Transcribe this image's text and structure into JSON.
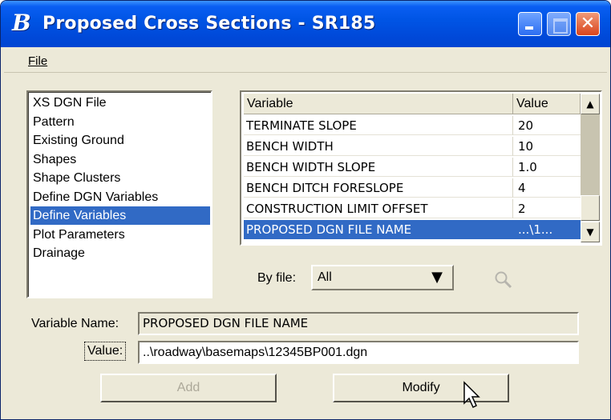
{
  "window": {
    "title": "Proposed Cross Sections - SR185",
    "app_icon": "bentley-b-icon"
  },
  "menu": {
    "file_label": "File"
  },
  "nav_list": {
    "items": [
      {
        "label": "XS DGN File",
        "selected": false
      },
      {
        "label": "Pattern",
        "selected": false
      },
      {
        "label": "Existing Ground",
        "selected": false
      },
      {
        "label": "Shapes",
        "selected": false
      },
      {
        "label": "Shape Clusters",
        "selected": false
      },
      {
        "label": "Define DGN Variables",
        "selected": false
      },
      {
        "label": "Define Variables",
        "selected": true
      },
      {
        "label": "Plot Parameters",
        "selected": false
      },
      {
        "label": "Drainage",
        "selected": false
      }
    ]
  },
  "variables_table": {
    "columns": [
      "Variable",
      "Value"
    ],
    "rows": [
      {
        "variable": "TERMINATE SLOPE",
        "value": "20",
        "selected": false
      },
      {
        "variable": "BENCH WIDTH",
        "value": "10",
        "selected": false
      },
      {
        "variable": "BENCH WIDTH SLOPE",
        "value": "1.0",
        "selected": false
      },
      {
        "variable": "BENCH DITCH FORESLOPE",
        "value": "4",
        "selected": false
      },
      {
        "variable": "CONSTRUCTION LIMIT OFFSET",
        "value": "2",
        "selected": false
      },
      {
        "variable": "PROPOSED DGN FILE NAME",
        "value": "...\\1...",
        "selected": true
      }
    ]
  },
  "filter": {
    "label": "By file:",
    "selected_option": "All"
  },
  "form": {
    "variable_name_label": "Variable Name:",
    "variable_name_value": "PROPOSED DGN FILE NAME",
    "value_label": "Value:",
    "value_value": "..\\roadway\\basemaps\\12345BP001.dgn"
  },
  "buttons": {
    "add_label": "Add",
    "modify_label": "Modify"
  },
  "colors": {
    "selection": "#316ac5",
    "titlebar": "#0055e5",
    "dialog_bg": "#ece9d8"
  }
}
